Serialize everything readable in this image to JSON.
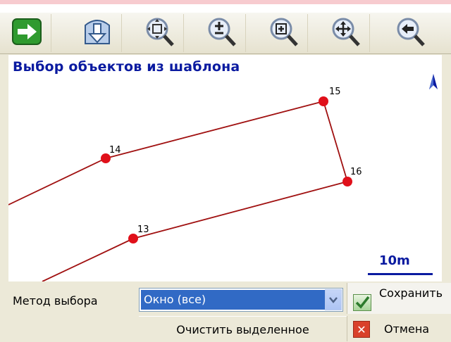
{
  "toolbar": {
    "buttons": [
      {
        "icon": "arrow-right-icon",
        "color": "#2f9a2f"
      },
      {
        "icon": "template-down-icon",
        "color": "#6e9cd6"
      },
      {
        "icon": "zoom-extents-icon",
        "color": "#8aa0c8"
      },
      {
        "icon": "zoom-in-out-icon",
        "color": "#8aa0c8"
      },
      {
        "icon": "zoom-window-icon",
        "color": "#8aa0c8"
      },
      {
        "icon": "pan-icon",
        "color": "#8aa0c8"
      },
      {
        "icon": "zoom-previous-icon",
        "color": "#8aa0c8"
      }
    ]
  },
  "map": {
    "title": "Выбор объектов из шаблона",
    "scale_label": "10m",
    "points": [
      {
        "label": "13"
      },
      {
        "label": "14"
      },
      {
        "label": "15"
      },
      {
        "label": "16"
      }
    ],
    "line_color": "#a01010",
    "point_color": "#e0101a",
    "title_color": "#0a1aa0"
  },
  "bottom": {
    "method_label": "Метод выбора",
    "method_value": "Окно (все)",
    "save_label": "Сохранить",
    "clear_label": "Очистить выделенное",
    "cancel_label": "Отмена"
  }
}
